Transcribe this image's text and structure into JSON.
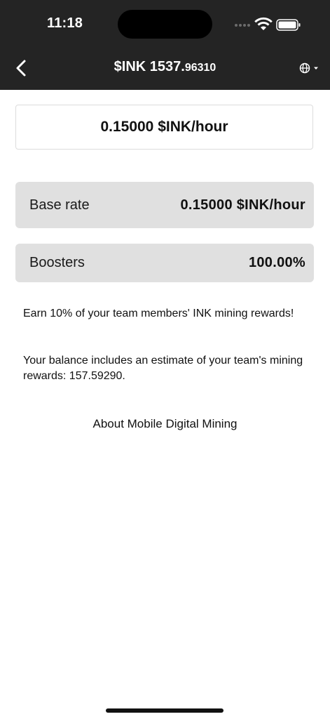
{
  "status_bar": {
    "time": "11:18",
    "icons": [
      "signal-dots-icon",
      "wifi-icon",
      "battery-icon"
    ]
  },
  "header": {
    "title_main": "$INK 1537.",
    "title_fraction": "96310",
    "back_icon": "chevron-left-icon",
    "language_icon": "globe-icon"
  },
  "rate": {
    "display": "0.15000 $INK/hour"
  },
  "base_rate": {
    "label": "Base rate",
    "value": "0.15000 $INK/hour"
  },
  "boosters": {
    "label": "Boosters",
    "value": "100.00%"
  },
  "info": {
    "team_reward": "Earn 10% of your team members' INK mining rewards!",
    "balance_estimate": "Your balance includes an estimate of your team's mining rewards: 157.59290."
  },
  "about_link": "About Mobile Digital Mining",
  "colors": {
    "header_bg": "#242424",
    "row_bg": "#e0e0e0",
    "text": "#111111"
  }
}
